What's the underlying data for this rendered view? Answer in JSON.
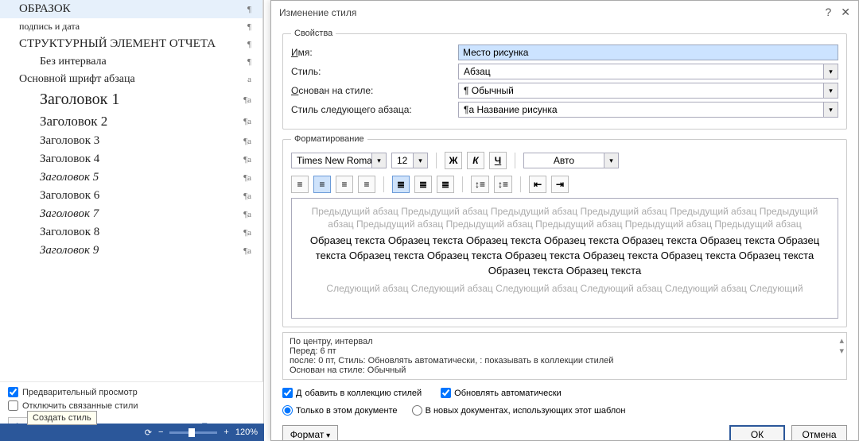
{
  "styles_panel": {
    "items": [
      {
        "label": "ОБРАЗОК",
        "ic": "¶",
        "cls": "caps"
      },
      {
        "label": "подпись и дата",
        "ic": "¶",
        "cls": "small"
      },
      {
        "label": "СТРУКТУРНЫЙ ЭЛЕМЕНТ ОТЧЕТА",
        "ic": "¶",
        "cls": "caps"
      },
      {
        "label": "Без интервала",
        "ic": "¶",
        "cls": "inset"
      },
      {
        "label": "Основной шрифт абзаца",
        "ic": "a",
        "cls": ""
      },
      {
        "label": "Заголовок 1",
        "ic": "¶a",
        "cls": "inset h1"
      },
      {
        "label": "Заголовок 2",
        "ic": "¶a",
        "cls": "inset h2"
      },
      {
        "label": "Заголовок 3",
        "ic": "¶a",
        "cls": "inset h3"
      },
      {
        "label": "Заголовок 4",
        "ic": "¶a",
        "cls": "inset h4"
      },
      {
        "label": "Заголовок 5",
        "ic": "¶a",
        "cls": "inset h5"
      },
      {
        "label": "Заголовок 6",
        "ic": "¶a",
        "cls": "inset h6"
      },
      {
        "label": "Заголовок 7",
        "ic": "¶a",
        "cls": "inset h7"
      },
      {
        "label": "Заголовок 8",
        "ic": "¶a",
        "cls": "inset h8"
      },
      {
        "label": "Заголовок 9",
        "ic": "¶a",
        "cls": "inset h9"
      }
    ],
    "preview_chk": "Предварительный просмотр",
    "linked_chk": "Отключить связанные стили",
    "params_link": "Параметры...",
    "tooltip": "Создать стиль"
  },
  "status": {
    "zoom": "120%"
  },
  "dialog": {
    "title": "Изменение стиля",
    "section_props": "Свойства",
    "section_format": "Форматирование",
    "name_lbl": "Имя:",
    "name_val": "Место рисунка",
    "style_lbl": "Стиль:",
    "style_val": "Абзац",
    "based_lbl": "Основан на стиле:",
    "based_val": "¶ Обычный",
    "next_lbl": "Стиль следующего абзаца:",
    "next_val": "¶a  Название рисунка",
    "font_family": "Times New Roman",
    "font_size": "12",
    "bold": "Ж",
    "italic": "К",
    "underline": "Ч",
    "color": "Авто",
    "preview_prev": "Предыдущий абзац Предыдущий абзац Предыдущий абзац Предыдущий абзац Предыдущий абзац Предыдущий абзац Предыдущий абзац Предыдущий абзац Предыдущий абзац Предыдущий абзац Предыдущий абзац",
    "preview_sample": "Образец текста Образец текста Образец текста Образец текста Образец текста Образец текста Образец текста Образец текста Образец текста Образец текста Образец текста Образец текста Образец текста Образец текста Образец текста",
    "preview_next": "Следующий абзац Следующий абзац Следующий абзац Следующий абзац Следующий абзац Следующий",
    "summary_l1": "По центру, интервал",
    "summary_l2": "Перед:  6 пт",
    "summary_l3": "после: 0 пт, Стиль: Обновлять автоматически, : показывать в коллекции стилей",
    "summary_l4": "Основан на стиле: Обычный",
    "add_collection": "Добавить в коллекцию стилей",
    "auto_update": "Обновлять автоматически",
    "only_doc": "Только в этом документе",
    "new_docs": "В новых документах, использующих этот шаблон",
    "format_btn": "Формат",
    "ok": "ОК",
    "cancel": "Отмена"
  }
}
